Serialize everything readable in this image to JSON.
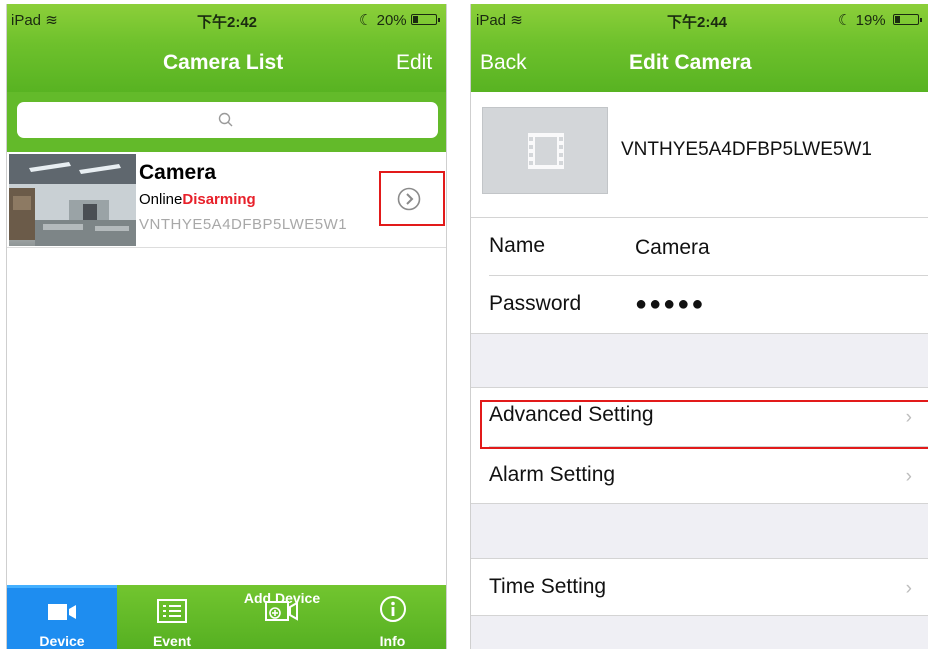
{
  "left": {
    "status": {
      "carrier": "iPad",
      "time": "下午2:42",
      "battery": "20%",
      "battery_level": 0.2
    },
    "nav": {
      "title": "Camera List",
      "edit_label": "Edit"
    },
    "search": {
      "icon": "search-icon"
    },
    "camera": {
      "name": "Camera",
      "status_online": "Online",
      "status_arm": "Disarming",
      "uid": "VNTHYE5A4DFBP5LWE5W1",
      "detail_icon": "chevron-circle-icon"
    },
    "tabs": [
      {
        "label": "Device",
        "icon": "video-camera-icon",
        "active": true
      },
      {
        "label": "Event",
        "icon": "list-icon",
        "active": false
      },
      {
        "label": "Add Device",
        "icon": "add-camera-icon",
        "active": false
      },
      {
        "label": "Info",
        "icon": "info-icon",
        "active": false
      }
    ]
  },
  "right": {
    "status": {
      "carrier": "iPad",
      "time": "下午2:44",
      "battery": "19%",
      "battery_level": 0.19
    },
    "nav": {
      "back_label": "Back",
      "title": "Edit Camera"
    },
    "camera": {
      "uid": "VNTHYE5A4DFBP5LWE5W1",
      "thumb_icon": "film-icon"
    },
    "fields": [
      {
        "label": "Name",
        "value": "Camera"
      },
      {
        "label": "Password",
        "value": "●●●●●"
      }
    ],
    "settings_group1": [
      "Advanced Setting",
      "Alarm Setting"
    ],
    "settings_group2": [
      "Time Setting"
    ]
  },
  "colors": {
    "header_green": "#6ec12c",
    "active_tab_blue": "#1e8df0",
    "alert_red": "#e8202a",
    "highlight_box": "#e21a1a"
  }
}
